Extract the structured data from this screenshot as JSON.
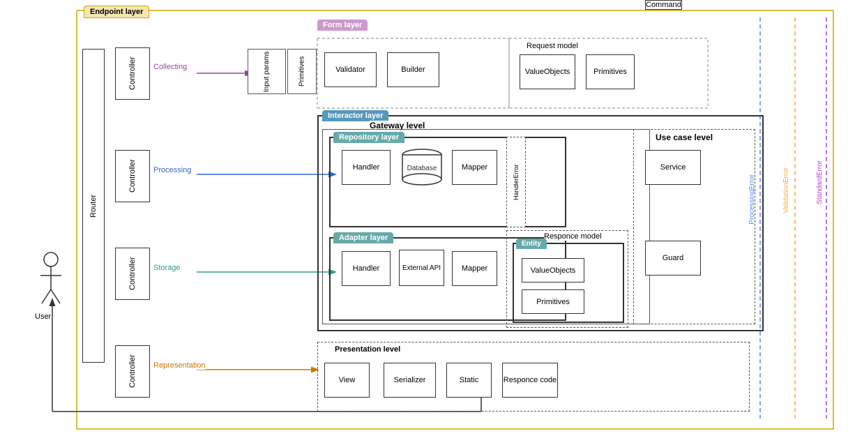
{
  "layers": {
    "endpoint": "Endpoint layer",
    "form": "Form layer",
    "interactor": "Interactor layer",
    "repository": "Repository layer",
    "adapter": "Adapter layer",
    "presentation": "Presentation level",
    "gateway": "Gateway level",
    "usecase": "Use case level",
    "requestmodel": "Request model",
    "responce_model": "Responce model"
  },
  "boxes": {
    "router": "Router",
    "user": "User",
    "ctrl1": "Controller",
    "ctrl2": "Controller",
    "ctrl3": "Controller",
    "ctrl4": "Controller",
    "validator": "Validator",
    "builder": "Builder",
    "valueobjects_req": "ValueObjects",
    "primitives_req": "Primitives",
    "input_params": "Input params",
    "primitives_form": "Primitives",
    "handler_repo": "Handler",
    "database": "Database",
    "mapper_repo": "Mapper",
    "handler_adapter": "Handler",
    "external_api": "External API",
    "mapper_adapter": "Mapper",
    "service": "Service",
    "command": "Command",
    "guard": "Guard",
    "entity": "Entity",
    "valueobjects_entity": "ValueObjects",
    "primitives_entity": "Primitives",
    "view": "View",
    "serializer": "Serializer",
    "static": "Static",
    "responce_code": "Responce code",
    "handler_error": "HandlerError"
  },
  "arrows": {
    "collecting": "Collecting",
    "processing": "Processing",
    "storage": "Storage",
    "representation": "Representation"
  },
  "errors": {
    "processing": "ProcessingError",
    "validation": "ValidationError",
    "standard": "StandardError"
  }
}
